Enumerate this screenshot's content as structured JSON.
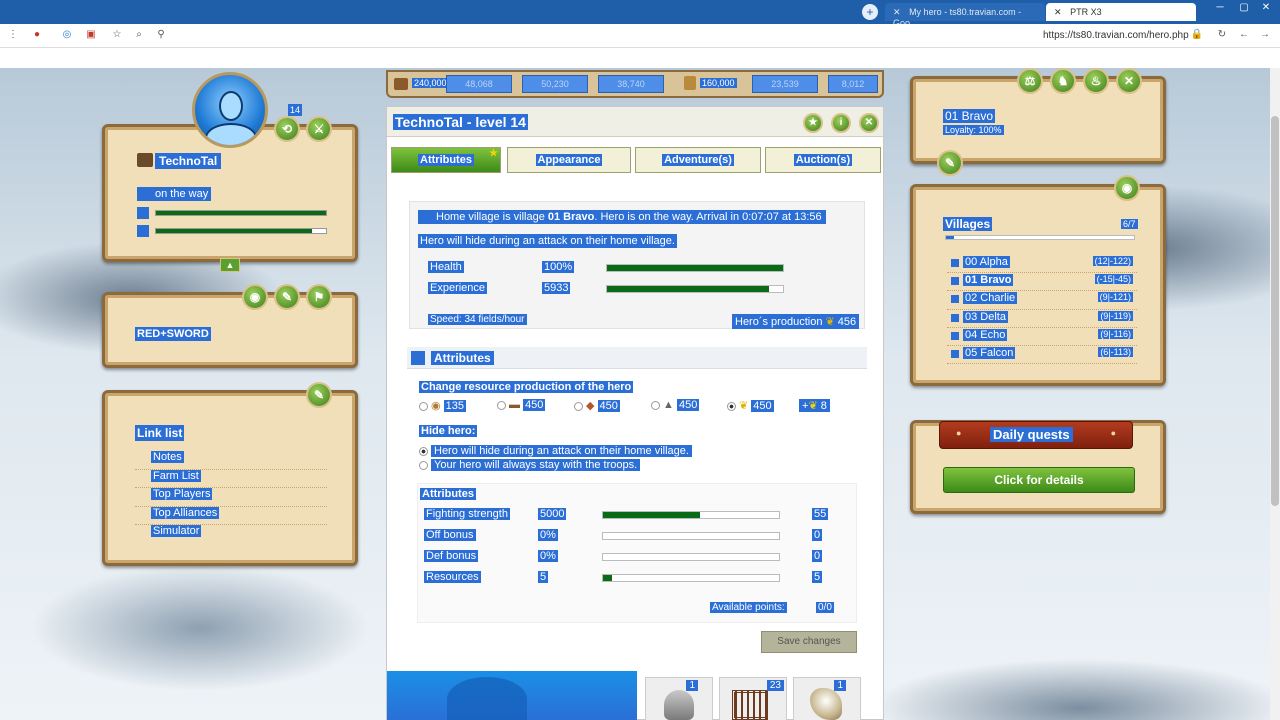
{
  "browser": {
    "tabs": [
      {
        "label": "My hero - ts80.travian.com - Goo"
      },
      {
        "label": "PTR X3"
      }
    ],
    "url": "https://ts80.travian.com/hero.php"
  },
  "resources_bar": {
    "wood": "240,000",
    "v2": "48,068",
    "v3": "50,230",
    "v4": "38,740",
    "crop": "160,000",
    "v6": "23,539",
    "v7": "8,012"
  },
  "hero_panel": {
    "name": "TechnoTal",
    "status": "on the way",
    "level_badge": "14",
    "health_pct": 100,
    "exp_pct": 92
  },
  "alliance_panel": {
    "name": "RED+SWORD"
  },
  "links_panel": {
    "title": "Link list",
    "items": [
      "Notes",
      "Farm List",
      "Top Players",
      "Top Alliances",
      "Simulator"
    ]
  },
  "village_panel": {
    "name": "01 Bravo",
    "loyalty": "Loyalty: 100%"
  },
  "villages_panel": {
    "title": "Villages",
    "count": "6/7",
    "items": [
      {
        "name": "00 Alpha",
        "coords": "(12|-122)"
      },
      {
        "name": "01 Bravo",
        "coords": "(-15|-45)"
      },
      {
        "name": "02 Charlie",
        "coords": "(9|-121)"
      },
      {
        "name": "03 Delta",
        "coords": "(9|-119)"
      },
      {
        "name": "04 Echo",
        "coords": "(9|-116)"
      },
      {
        "name": "05 Falcon",
        "coords": "(6|-113)"
      }
    ]
  },
  "quests": {
    "title": "Daily quests",
    "button": "Click for details"
  },
  "hero": {
    "title": "TechnoTal - level 14",
    "tabs": [
      "Attributes",
      "Appearance",
      "Adventure(s)",
      "Auction(s)"
    ],
    "home_msg_prefix": "Home village is village",
    "home_village": "01 Bravo",
    "home_msg_suffix": ". Hero is on the way. Arrival in 0:07:07 at 13:56",
    "hide_msg": "Hero will hide during an attack on their home village.",
    "health_label": "Health",
    "health_value": "100%",
    "health_pct": 100,
    "exp_label": "Experience",
    "exp_value": "5933",
    "exp_pct": 92,
    "speed": "Speed: 34 fields/hour",
    "production_label": "Hero´s production",
    "production_value": "456",
    "attributes_header": "Attributes",
    "change_prod_label": "Change resource production of the hero",
    "prod_options": [
      "135",
      "450",
      "450",
      "450",
      "450"
    ],
    "prod_plus": "8",
    "hide_label": "Hide hero:",
    "hide_opt1": "Hero will hide during an attack on their home village.",
    "hide_opt2": "Your hero will always stay with the troops.",
    "attr_subheader": "Attributes",
    "attrs": [
      {
        "name": "Fighting strength",
        "value": "5000",
        "points": "55",
        "pct": 55
      },
      {
        "name": "Off bonus",
        "value": "0%",
        "points": "0",
        "pct": 0
      },
      {
        "name": "Def bonus",
        "value": "0%",
        "points": "0",
        "pct": 0
      },
      {
        "name": "Resources",
        "value": "5",
        "points": "5",
        "pct": 5
      }
    ],
    "available_label": "Available points:",
    "available_value": "0/0",
    "save_button": "Save changes"
  },
  "inventory": [
    {
      "count": "1"
    },
    {
      "count": "23"
    },
    {
      "count": "1"
    }
  ]
}
